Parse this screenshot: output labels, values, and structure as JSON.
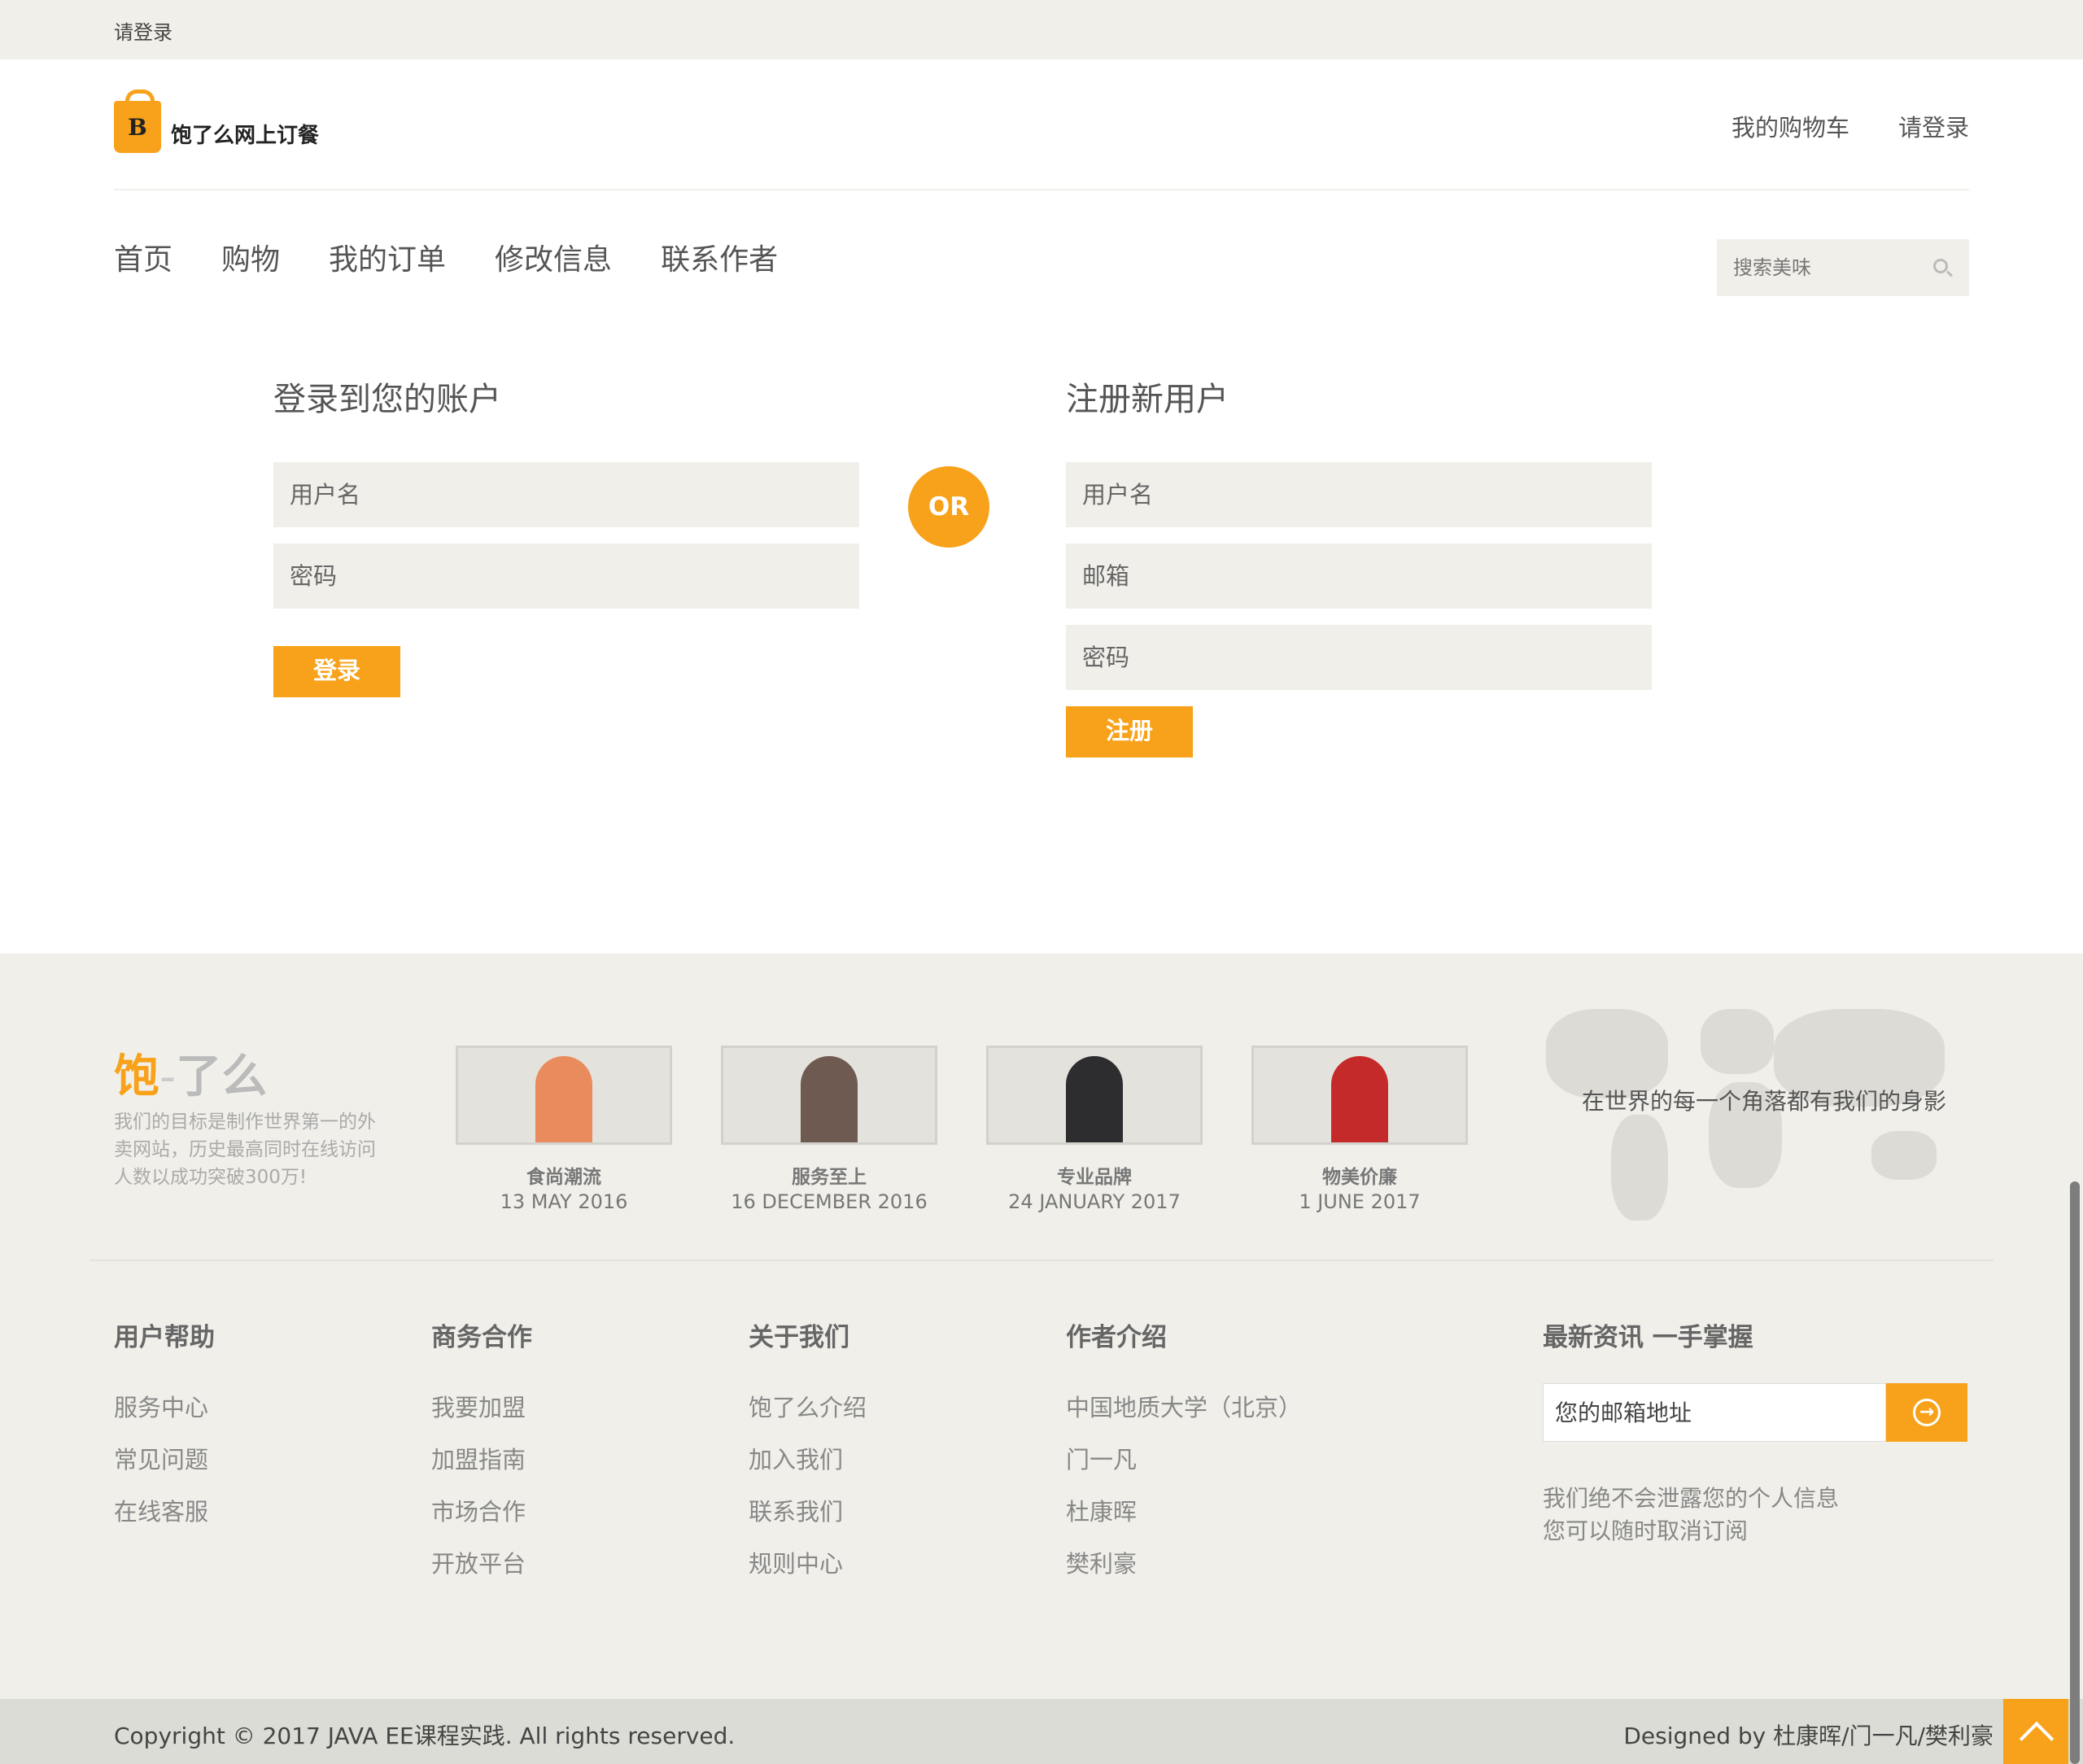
{
  "topbar": {
    "login_link": "请登录"
  },
  "logo": {
    "letter": "B",
    "text": "饱了么网上订餐"
  },
  "header": {
    "cart_link": "我的购物车",
    "login_link": "请登录"
  },
  "nav": {
    "items": [
      "首页",
      "购物",
      "我的订单",
      "修改信息",
      "联系作者"
    ]
  },
  "search": {
    "placeholder": "搜索美味",
    "icon": "search-icon"
  },
  "login": {
    "title": "登录到您的账户",
    "username_placeholder": "用户名",
    "password_placeholder": "密码",
    "button": "登录"
  },
  "or_label": "OR",
  "register": {
    "title": "注册新用户",
    "username_placeholder": "用户名",
    "email_placeholder": "邮箱",
    "password_placeholder": "密码",
    "button": "注册"
  },
  "footer": {
    "brand": {
      "part1": "饱",
      "sep": "-",
      "part2": "了么"
    },
    "description": "我们的目标是制作世界第一的外卖网站，历史最高同时在线访问人数以成功突破300万!",
    "features": [
      {
        "title": "食尚潮流",
        "date": "13 MAY 2016"
      },
      {
        "title": "服务至上",
        "date": "16 DECEMBER 2016"
      },
      {
        "title": "专业品牌",
        "date": "24 JANUARY 2017"
      },
      {
        "title": "物美价廉",
        "date": "1 JUNE 2017"
      }
    ],
    "map_caption": "在世界的每一个角落都有我们的身影",
    "columns": [
      {
        "heading": "用户帮助",
        "links": [
          "服务中心",
          "常见问题",
          "在线客服"
        ]
      },
      {
        "heading": "商务合作",
        "links": [
          "我要加盟",
          "加盟指南",
          "市场合作",
          "开放平台"
        ]
      },
      {
        "heading": "关于我们",
        "links": [
          "饱了么介绍",
          "加入我们",
          "联系我们",
          "规则中心"
        ]
      },
      {
        "heading": "作者介绍",
        "links": [
          "中国地质大学（北京）",
          "门一凡",
          "杜康晖",
          "樊利豪"
        ]
      }
    ],
    "subscribe": {
      "title": "最新资讯 一手掌握",
      "placeholder": "您的邮箱地址",
      "note_line1": "我们绝不会泄露您的个人信息",
      "note_line2": "您可以随时取消订阅"
    },
    "copyright": "Copyright © 2017 JAVA EE课程实践. All rights reserved.",
    "designed_by": "Designed by 杜康晖/门一凡/樊利豪"
  },
  "colors": {
    "accent": "#f7a21a",
    "light_bg": "#f0efea",
    "bottom_bar": "#dcdcd6"
  }
}
